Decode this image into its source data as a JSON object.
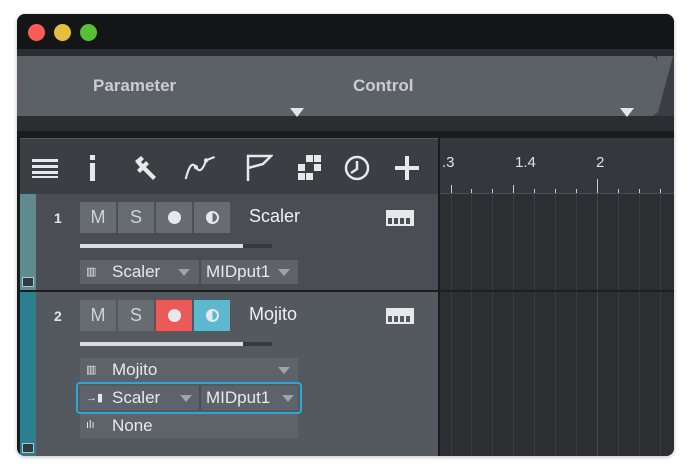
{
  "header": {
    "parameter_label": "Parameter",
    "control_label": "Control"
  },
  "toolbar": {
    "icons": [
      "list-icon",
      "info-icon",
      "wrench-icon",
      "automation-curve-icon",
      "flag-icon",
      "grid-icon",
      "clock-icon",
      "add-icon"
    ]
  },
  "ruler": {
    "labels": [
      ".3",
      "1.4",
      "2"
    ]
  },
  "tracks": [
    {
      "number": "1",
      "mute": "M",
      "solo": "S",
      "name": "Scaler",
      "volume_fraction": 0.85,
      "record_armed": false,
      "monitor_on": false,
      "input_device": "Scaler",
      "output": "MIDput1"
    },
    {
      "number": "2",
      "mute": "M",
      "solo": "S",
      "name": "Mojito",
      "volume_fraction": 0.85,
      "record_armed": true,
      "monitor_on": true,
      "instrument": "Mojito",
      "input_device": "Scaler",
      "output": "MIDput1",
      "insert": "None"
    }
  ],
  "colors": {
    "record": "#ea5a58",
    "monitor": "#5cb7cf",
    "focus": "#2aa6d9"
  }
}
